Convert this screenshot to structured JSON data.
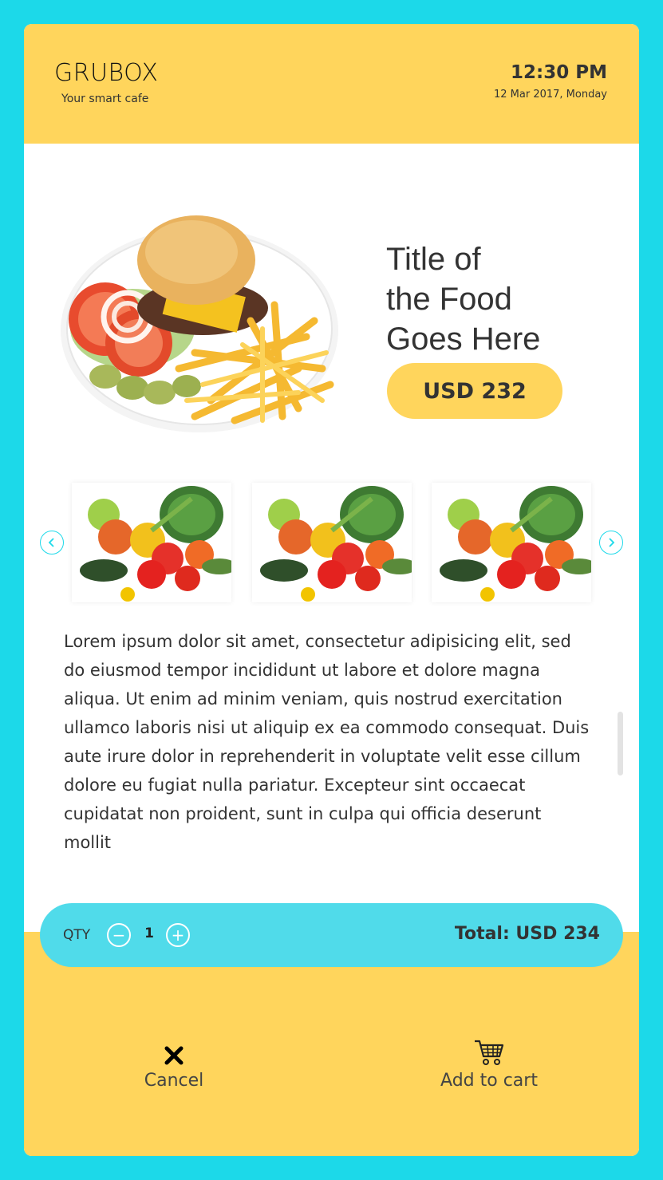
{
  "header": {
    "brand": "GRUBOX",
    "tagline": "Your smart cafe",
    "time": "12:30 PM",
    "date": "12 Mar 2017, Monday"
  },
  "product": {
    "title_lines": [
      "Title of",
      "the Food",
      "Goes Here"
    ],
    "price": "USD 232",
    "image_icon": "burger-plate-image",
    "description": "Lorem ipsum dolor sit amet, consectetur adipisicing elit, sed do eiusmod tempor incididunt ut labore et dolore magna aliqua. Ut enim ad minim veniam, quis nostrud exercitation ullamco laboris nisi ut aliquip ex ea commodo consequat. Duis aute irure dolor in reprehenderit in voluptate velit esse cillum dolore eu fugiat nulla pariatur. Excepteur sint occaecat cupidatat non proident, sunt in culpa qui officia deserunt mollit"
  },
  "gallery": {
    "prev_icon": "chevron-left-icon",
    "next_icon": "chevron-right-icon",
    "thumbnails": [
      "vegetables-image",
      "vegetables-image",
      "vegetables-image"
    ]
  },
  "order": {
    "qty_label": "QTY",
    "qty_value": "1",
    "minus_symbol": "−",
    "plus_symbol": "+",
    "total": "Total: USD 234"
  },
  "actions": {
    "cancel_label": "Cancel",
    "add_to_cart_label": "Add to cart"
  },
  "colors": {
    "background": "#1cd9e9",
    "accent_yellow": "#ffd55c",
    "qty_bar": "#50dbea",
    "text": "#333333"
  }
}
